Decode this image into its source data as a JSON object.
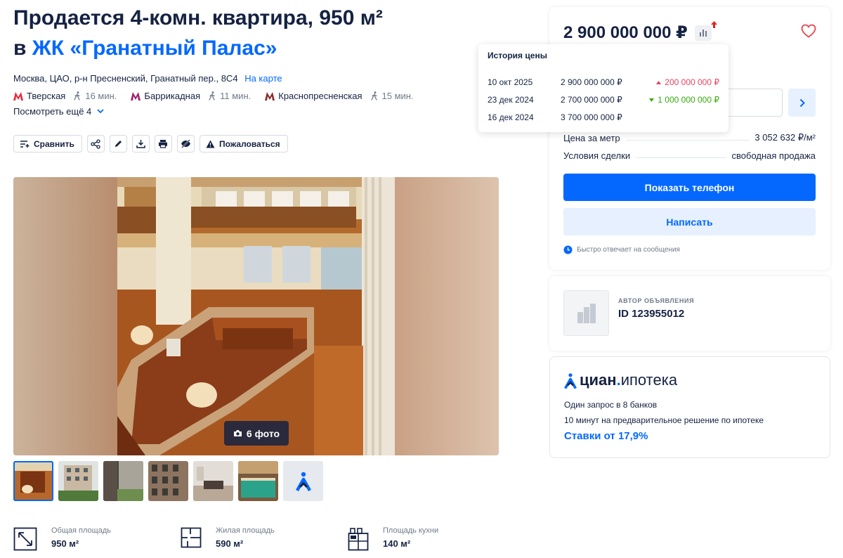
{
  "listing": {
    "title_line1": "Продается 4-комн. квартира, 950 м²",
    "title_prefix": "в",
    "complex_link": "ЖК «Гранатный Палас»",
    "address": "Москва, ЦАО, р-н Пресненский, Гранатный пер., 8С4",
    "map_link": "На карте",
    "metro": [
      {
        "name": "Тверская",
        "walk": "16 мин."
      },
      {
        "name": "Баррикадная",
        "walk": "11 мин."
      },
      {
        "name": "Краснопресненская",
        "walk": "15 мин."
      }
    ],
    "more_link": "Посмотреть ещё 4",
    "metro_color": "#e6283c"
  },
  "toolbar": {
    "compare_label": "Сравнить",
    "report_label": "Пожаловаться",
    "icons": [
      "share-icon",
      "edit-icon",
      "download-icon",
      "print-icon",
      "hide-icon"
    ]
  },
  "gallery": {
    "photo_count": "6 фото",
    "thumbnails": [
      "photo-1",
      "photo-2",
      "photo-3",
      "photo-4",
      "photo-5",
      "photo-6",
      "cian-logo"
    ]
  },
  "facts": [
    {
      "label": "Общая площадь",
      "value": "950 м²",
      "icon": "total-area-icon"
    },
    {
      "label": "Жилая площадь",
      "value": "590 м²",
      "icon": "living-area-icon"
    },
    {
      "label": "Площадь кухни",
      "value": "140 м²",
      "icon": "kitchen-area-icon"
    }
  ],
  "price_card": {
    "price": "2 900 000 000 ₽",
    "price_per_meter_label": "Цена за метр",
    "price_per_meter": "3 052 632 ₽/м²",
    "deal_label": "Условия сделки",
    "deal_value": "свободная продажа",
    "show_phone": "Показать телефон",
    "write": "Написать",
    "fast_reply": "Быстро отвечает на сообщения",
    "accent": "#0468ff"
  },
  "price_history": {
    "title": "История цены",
    "rows": [
      {
        "date": "10 окт 2025",
        "price": "2 900 000 000 ₽",
        "diff": "200 000 000 ₽",
        "direction": "up"
      },
      {
        "date": "23 дек 2024",
        "price": "2 700 000 000 ₽",
        "diff": "1 000 000 000 ₽",
        "direction": "down"
      },
      {
        "date": "16 дек 2024",
        "price": "3 700 000 000 ₽",
        "diff": "",
        "direction": ""
      }
    ]
  },
  "author": {
    "role": "АВТОР ОБЪЯВЛЕНИЯ",
    "id": "ID 123955012"
  },
  "ipoteka": {
    "brand": "циан",
    "dot": ".",
    "product": "ипотека",
    "line1": "Один запрос в 8 банков",
    "line2": "10 минут на предварительное решение по ипотеке",
    "rate": "Ставки от 17,9%"
  }
}
